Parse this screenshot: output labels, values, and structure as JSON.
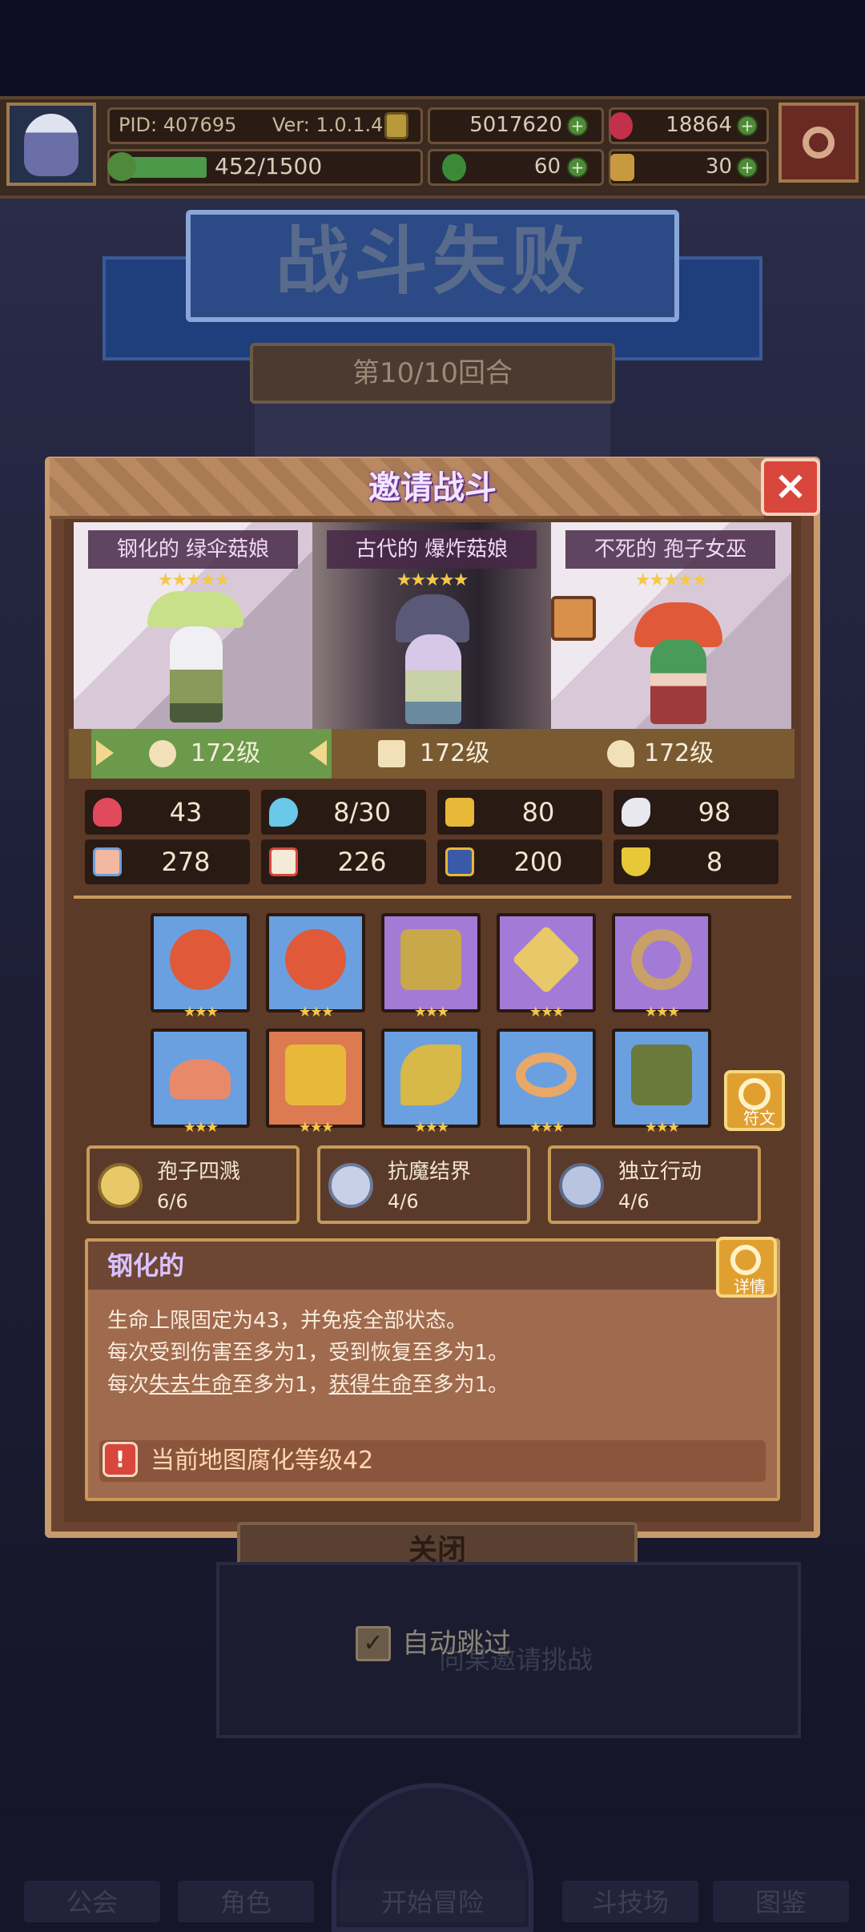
{
  "topbar": {
    "pid": "PID: 407695",
    "ver": "Ver: 1.0.1.4",
    "gold": "5017620",
    "gems": "18864",
    "stamina": "452/1500",
    "clover": "60",
    "key": "30",
    "stamina_fraction": 0.301
  },
  "scene": {
    "result_title": "战斗失败",
    "round": "第10/10回合"
  },
  "modal": {
    "title": "邀请战斗",
    "enemies": [
      {
        "name": "钢化的 绿伞菇娘",
        "stars": "★★★★★"
      },
      {
        "name": "古代的 爆炸菇娘",
        "stars": "★★★★★"
      },
      {
        "name": "不死的 孢子女巫",
        "stars": "★★★★★"
      }
    ],
    "levels": [
      "172级",
      "172级",
      "172级"
    ],
    "stats": [
      "43",
      "8/30",
      "80",
      "98",
      "278",
      "226",
      "200",
      "8"
    ],
    "item_stars": "★★★",
    "rune_label": "符文",
    "skills": [
      {
        "name": "孢子四溅",
        "count": "6/6"
      },
      {
        "name": "抗魔结界",
        "count": "4/6"
      },
      {
        "name": "独立行动",
        "count": "4/6"
      }
    ],
    "desc": {
      "title": "钢化的",
      "detail_label": "详情",
      "line1": "生命上限固定为43，并免疫全部状态。",
      "line2": "每次受到伤害至多为1，受到恢复至多为1。",
      "line3_a": "每次",
      "line3_b": "失去生命",
      "line3_c": "至多为1，",
      "line3_d": "获得生命",
      "line3_e": "至多为1。",
      "warning": "当前地图腐化等级42"
    }
  },
  "below": {
    "close_label": "关闭",
    "auto_skip": "自动跳过",
    "challenge": "向某邀请挑战"
  },
  "nav": [
    "公会",
    "角色",
    "开始冒险",
    "斗技场",
    "图鉴"
  ],
  "colors": {
    "accent_red": "#d8463c",
    "star": "#f4c84a",
    "modal_border": "#c89a6a"
  }
}
